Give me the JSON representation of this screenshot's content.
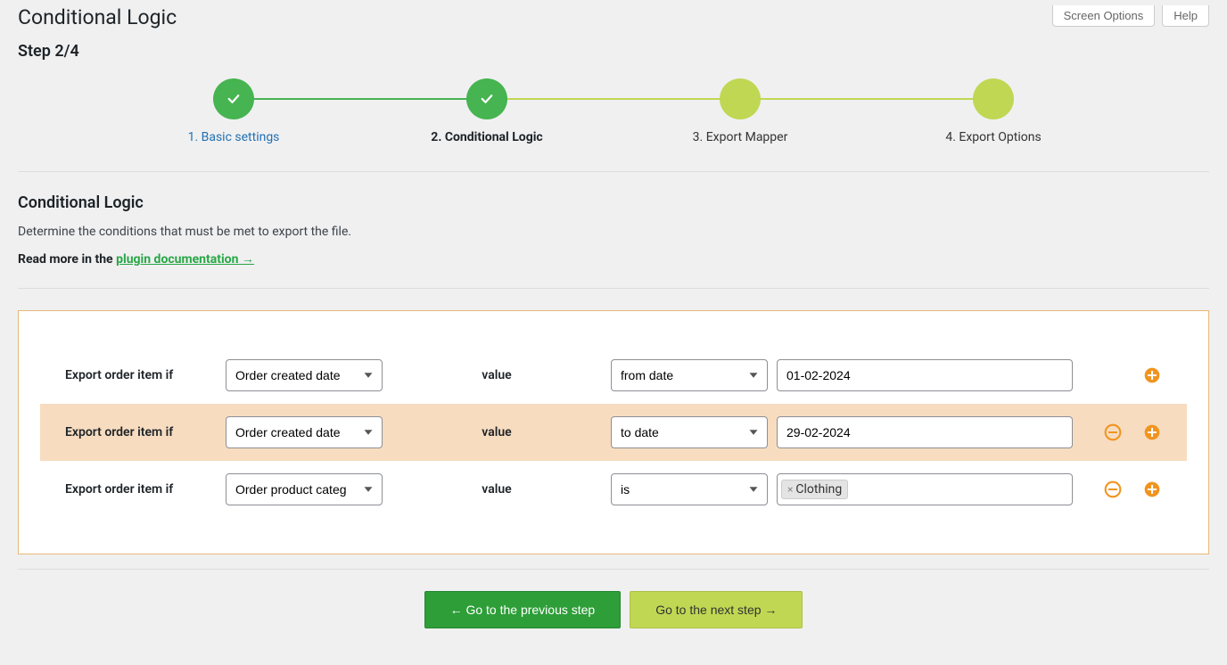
{
  "header": {
    "page_title": "Conditional Logic",
    "screen_options": "Screen Options",
    "help": "Help"
  },
  "step_label": "Step 2/4",
  "steps": [
    {
      "label": "1. Basic settings",
      "state": "done"
    },
    {
      "label": "2. Conditional Logic",
      "state": "current"
    },
    {
      "label": "3. Export Mapper",
      "state": "pending"
    },
    {
      "label": "4. Export Options",
      "state": "pending"
    }
  ],
  "section": {
    "title": "Conditional Logic",
    "desc": "Determine the conditions that must be met to export the file.",
    "readmore_prefix": "Read more in the ",
    "readmore_link": "plugin documentation →"
  },
  "rule_labels": {
    "export_if": "Export order item if",
    "value": "value"
  },
  "rules": [
    {
      "field": "Order created date",
      "operator": "from date",
      "value": "01-02-2024",
      "highlight": false,
      "has_remove": false,
      "has_add": true,
      "value_type": "text"
    },
    {
      "field": "Order created date",
      "operator": "to date",
      "value": "29-02-2024",
      "highlight": true,
      "has_remove": true,
      "has_add": true,
      "value_type": "text"
    },
    {
      "field": "Order product categ",
      "operator": "is",
      "value": "Clothing",
      "highlight": false,
      "has_remove": true,
      "has_add": true,
      "value_type": "tag"
    }
  ],
  "nav": {
    "prev": "← Go to the previous step",
    "next": "Go to the next step →"
  }
}
